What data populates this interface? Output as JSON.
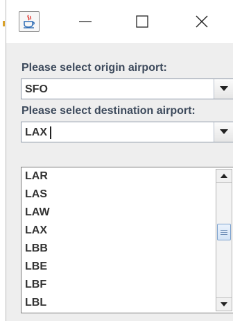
{
  "window": {
    "controls": {
      "minimize_icon": "minimize-icon",
      "maximize_icon": "maximize-icon",
      "close_icon": "close-icon"
    },
    "app_icon": "java-cup-icon"
  },
  "form": {
    "origin_label": "Please select origin airport:",
    "origin_value": "SFO",
    "destination_label": "Please select destination airport:",
    "destination_value": "LAX"
  },
  "dropdown": {
    "items": [
      "LAR",
      "LAS",
      "LAW",
      "LAX",
      "LBB",
      "LBE",
      "LBF",
      "LBL"
    ],
    "scroll_position_fraction": 0.42
  },
  "colors": {
    "label_text": "#3d4a5c",
    "thumb_accent": "#7da2ce"
  }
}
